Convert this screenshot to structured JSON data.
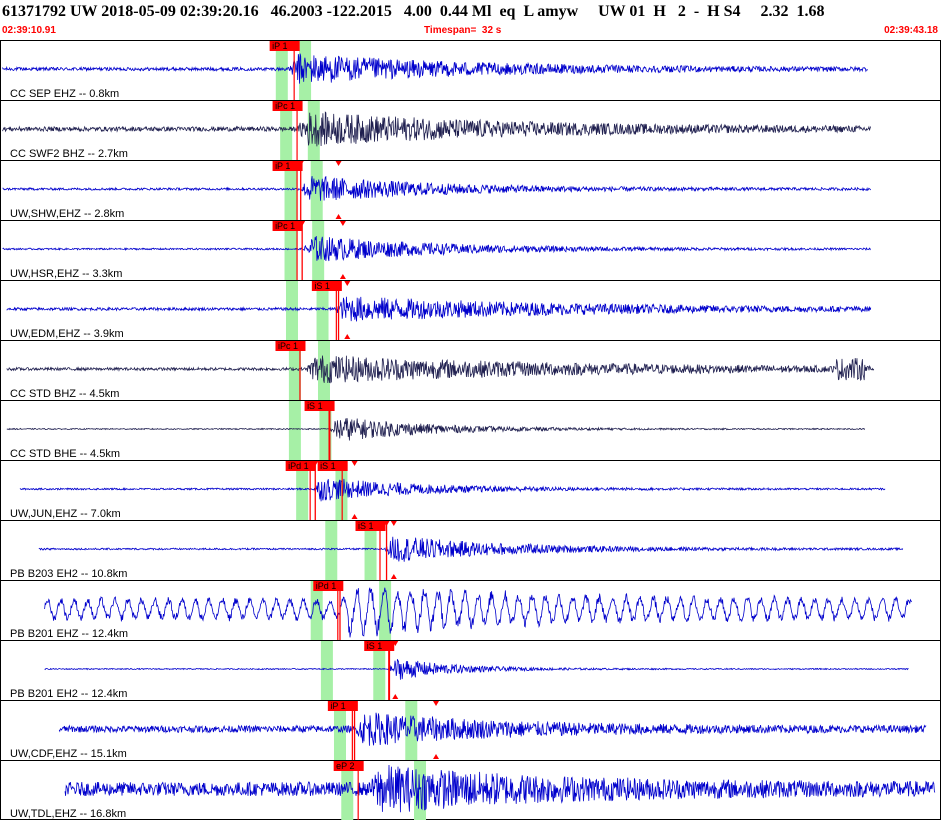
{
  "header": {
    "title": "61371792 UW 2018-05-09 02:39:20.16   46.2003 -122.2015   4.00  0.44 Ml  eq  L amyw     UW 01  H   2  -  H S4     2.32  1.68",
    "start_time": "02:39:10.91",
    "timespan": "Timespan=  32 s",
    "end_time": "02:39:43.18"
  },
  "chart_data": {
    "type": "line",
    "time_range": [
      0,
      32.27
    ],
    "colors": {
      "trace_blue": "#0000cc",
      "trace_navy": "#202050",
      "pick_red": "#ff0000",
      "window_green": "#a6f0a6",
      "divider": "#000000"
    },
    "traces": [
      {
        "label": "CC SEP EHZ -- 0.8km",
        "color": "navy_blue",
        "data_start": 0.05,
        "data_end": 29.8,
        "noise": 0.06,
        "onset": 9.9,
        "peak": 0.55,
        "decay": 6,
        "gutenberg": false,
        "greens": [
          9.65,
          10.45
        ],
        "picks": [
          {
            "label": "iP 1",
            "t": 9.25,
            "kind": "label"
          }
        ]
      },
      {
        "label": "CC SWF2 BHZ -- 2.7km",
        "color": "navy",
        "data_start": 0.05,
        "data_end": 29.9,
        "noise": 0.08,
        "onset": 10.2,
        "peak": 0.6,
        "decay": 7,
        "gutenberg": false,
        "greens": [
          9.8,
          10.75
        ],
        "picks": [
          {
            "label": "iPc 1",
            "t": 9.35,
            "kind": "label"
          }
        ]
      },
      {
        "label": "UW,SHW,EHZ -- 2.8km",
        "color": "navy_blue",
        "data_start": 0.05,
        "data_end": 29.9,
        "noise": 0.04,
        "onset": 10.3,
        "peak": 0.5,
        "decay": 4.5,
        "gutenberg": false,
        "greens": [
          9.95,
          10.85
        ],
        "picks": [
          {
            "label": "iP 1",
            "t": 9.35,
            "kind": "label"
          },
          {
            "label": "",
            "t": 10.3,
            "kind": "line"
          },
          {
            "label": "",
            "t": 11.6,
            "kind": "tri"
          }
        ]
      },
      {
        "label": "UW,HSR,EHZ -- 3.3km",
        "color": "navy_blue",
        "data_start": 0.05,
        "data_end": 29.9,
        "noise": 0.03,
        "onset": 10.4,
        "peak": 0.5,
        "decay": 4.5,
        "gutenberg": false,
        "greens": [
          9.95,
          10.9
        ],
        "picks": [
          {
            "label": "iPc 1",
            "t": 9.35,
            "kind": "label"
          },
          {
            "label": "",
            "t": 10.35,
            "kind": "line"
          },
          {
            "label": "",
            "t": 11.75,
            "kind": "tri"
          }
        ]
      },
      {
        "label": "UW,EDM,EHZ -- 3.9km",
        "color": "navy_blue",
        "data_start": 0.2,
        "data_end": 29.9,
        "noise": 0.05,
        "onset": 11.5,
        "peak": 0.45,
        "decay": 8,
        "gutenberg": false,
        "greens": [
          10.0,
          11.05
        ],
        "picks": [
          {
            "label": "iS 1",
            "t": 10.7,
            "kind": "label"
          },
          {
            "label": "",
            "t": 11.6,
            "kind": "line"
          },
          {
            "label": "",
            "t": 11.9,
            "kind": "tri"
          }
        ]
      },
      {
        "label": "CC STD BHZ -- 4.5km",
        "color": "navy",
        "data_start": 0.2,
        "data_end": 30.0,
        "noise": 0.05,
        "onset": 10.5,
        "peak": 0.5,
        "decay": 9,
        "gutenberg": false,
        "burst": 28.7,
        "greens": [
          10.1,
          11.1
        ],
        "picks": [
          {
            "label": "iPc 1",
            "t": 9.45,
            "kind": "label"
          }
        ]
      },
      {
        "label": "CC STD BHE -- 4.5km",
        "color": "navy",
        "data_start": 0.2,
        "data_end": 29.7,
        "noise": 0.02,
        "onset": 11.3,
        "peak": 0.5,
        "decay": 3,
        "gutenberg": false,
        "greens": [
          10.1,
          11.15
        ],
        "picks": [
          {
            "label": "iS 1",
            "t": 10.45,
            "kind": "label"
          },
          {
            "label": "",
            "t": 11.3,
            "kind": "line"
          }
        ]
      },
      {
        "label": "UW,JUN,EHZ -- 7.0km",
        "color": "navy_blue",
        "data_start": 0.65,
        "data_end": 30.4,
        "noise": 0.03,
        "onset": 10.7,
        "peak": 0.45,
        "decay": 3.5,
        "gutenberg": false,
        "greens": [
          10.35,
          11.7
        ],
        "picks": [
          {
            "label": "iPd 1",
            "t": 9.8,
            "kind": "label"
          },
          {
            "label": "iS 1",
            "t": 10.9,
            "kind": "label"
          },
          {
            "label": "",
            "t": 10.8,
            "kind": "line"
          },
          {
            "label": "",
            "t": 12.15,
            "kind": "tri"
          }
        ]
      },
      {
        "label": "PB B203 EH2 -- 10.8km",
        "color": "navy_blue",
        "data_start": 1.3,
        "data_end": 31.0,
        "noise": 0.03,
        "onset": 13.2,
        "peak": 0.5,
        "decay": 4,
        "gutenberg": false,
        "greens": [
          11.35,
          12.7
        ],
        "picks": [
          {
            "label": "iS 1",
            "t": 12.2,
            "kind": "label"
          },
          {
            "label": "",
            "t": 13.25,
            "kind": "line"
          },
          {
            "label": "",
            "t": 13.5,
            "kind": "tri"
          }
        ]
      },
      {
        "label": "PB B201 EHZ -- 12.4km",
        "color": "navy_blue",
        "data_start": 1.5,
        "data_end": 31.3,
        "noise": 0.32,
        "onset": 11.7,
        "peak": 0.5,
        "decay": 5,
        "gutenberg": true,
        "greens": [
          10.85,
          13.2
        ],
        "picks": [
          {
            "label": "iPd 1",
            "t": 10.75,
            "kind": "label"
          },
          {
            "label": "",
            "t": 11.65,
            "kind": "line"
          }
        ]
      },
      {
        "label": "PB B201 EH2 -- 12.4km",
        "color": "navy_blue",
        "data_start": 1.5,
        "data_end": 31.2,
        "noise": 0.02,
        "onset": 13.3,
        "peak": 0.45,
        "decay": 2,
        "gutenberg": false,
        "greens": [
          11.2,
          13.0
        ],
        "picks": [
          {
            "label": "iS 1",
            "t": 12.5,
            "kind": "label"
          },
          {
            "label": "",
            "t": 13.35,
            "kind": "line"
          },
          {
            "label": "",
            "t": 13.55,
            "kind": "tri"
          }
        ]
      },
      {
        "label": "UW,CDF,EHZ -- 15.1km",
        "color": "navy_blue",
        "data_start": 2.0,
        "data_end": 31.8,
        "noise": 0.12,
        "onset": 12.2,
        "peak": 0.55,
        "decay": 5,
        "gutenberg": false,
        "greens": [
          11.65,
          14.1
        ],
        "picks": [
          {
            "label": "iP 1",
            "t": 11.25,
            "kind": "label"
          },
          {
            "label": "",
            "t": 12.15,
            "kind": "line"
          },
          {
            "label": "",
            "t": 14.95,
            "kind": "tri"
          }
        ]
      },
      {
        "label": "UW,TDL,EHZ -- 16.8km",
        "color": "navy_blue",
        "data_start": 2.2,
        "data_end": 32.1,
        "noise": 0.25,
        "onset": 12.7,
        "peak": 0.7,
        "decay": 6,
        "gutenberg": false,
        "greens": [
          11.9,
          14.4
        ],
        "picks": [
          {
            "label": "eP 2",
            "t": 11.45,
            "kind": "label"
          }
        ]
      }
    ]
  }
}
